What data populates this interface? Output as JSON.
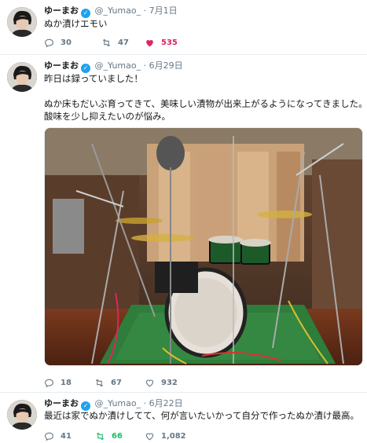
{
  "tweets": [
    {
      "name": "ゆーまお",
      "handle": "@_Yumao_",
      "dot": "·",
      "date": "7月1日",
      "lines": [
        "ぬか漬けエモい"
      ],
      "replies": "30",
      "retweets": "47",
      "likes": "535",
      "liked": true,
      "retweeted": false
    },
    {
      "name": "ゆーまお",
      "handle": "@_Yumao_",
      "dot": "·",
      "date": "6月29日",
      "lines": [
        "昨日は録っていました！",
        "",
        "ぬか床もだいぶ育ってきて、美味しい漬物が出来上がるようになってきました。",
        "酸味を少し抑えたいのが悩み。"
      ],
      "replies": "18",
      "retweets": "67",
      "likes": "932",
      "liked": false,
      "retweeted": false
    },
    {
      "name": "ゆーまお",
      "handle": "@_Yumao_",
      "dot": "·",
      "date": "6月22日",
      "lines": [
        "最近は家でぬか漬けしてて、何が言いたいかって自分で作ったぬか漬け最高。"
      ],
      "replies": "41",
      "retweets": "66",
      "likes": "1,082",
      "liked": false,
      "retweeted": true
    }
  ],
  "colors": {
    "muted": "#657786",
    "like": "#e0245e",
    "retweet": "#17bf63",
    "verified": "#1da1f2"
  },
  "icons": {
    "reply": "reply-icon",
    "retweet": "retweet-icon",
    "like": "heart-icon",
    "verified": "verified-badge-icon"
  }
}
